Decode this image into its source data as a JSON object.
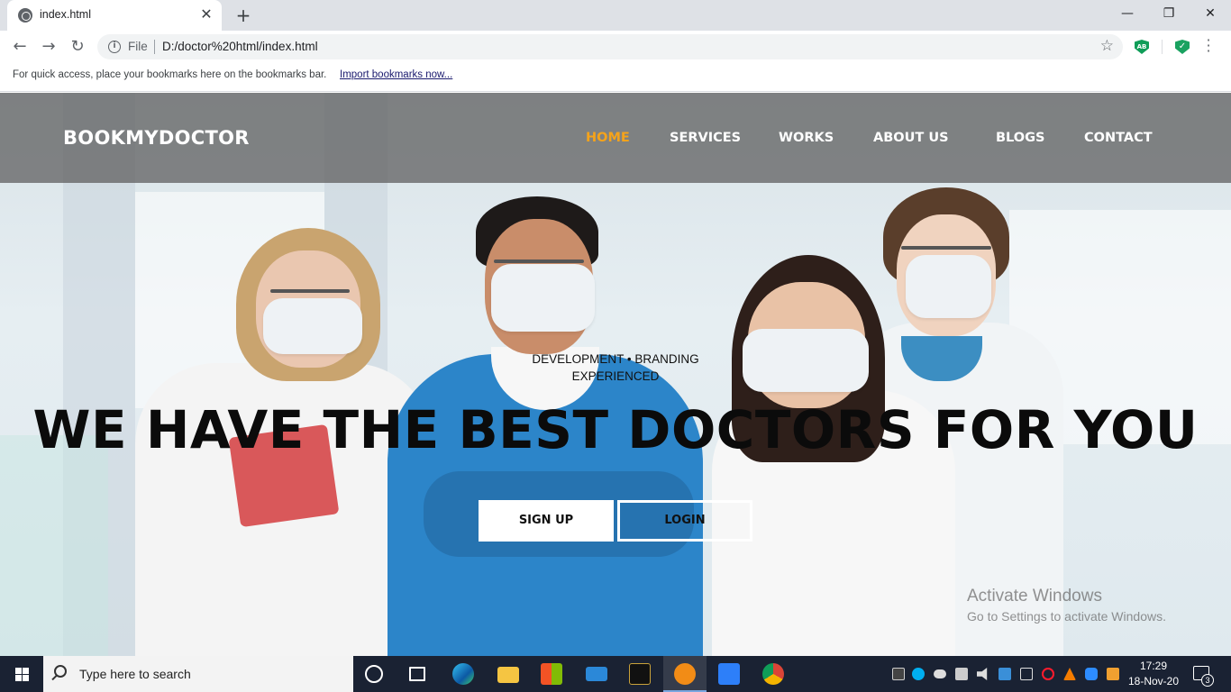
{
  "browser": {
    "tab_title": "index.html",
    "tab_close": "✕",
    "new_tab": "+",
    "minimize": "—",
    "maximize": "❐",
    "close": "✕",
    "back": "←",
    "forward": "→",
    "reload": "↻",
    "file_label": "File",
    "url": "D:/doctor%20html/index.html",
    "star": "☆",
    "ext_ab_label": "AB",
    "ext_shield_label": "✓",
    "bookmarks_text": "For quick access, place your bookmarks here on the bookmarks bar.",
    "bookmarks_link": "Import bookmarks now..."
  },
  "site": {
    "brand": "BOOKMYDOCTOR",
    "nav": [
      {
        "label": "HOME",
        "active": true
      },
      {
        "label": "SERVICES",
        "active": false
      },
      {
        "label": "WORKS",
        "active": false
      },
      {
        "label": "ABOUT US",
        "active": false
      },
      {
        "label": "BLOGS",
        "active": false
      },
      {
        "label": "CONTACT",
        "active": false
      }
    ],
    "hero_sub_line1": "DEVELOPMENT • BRANDING",
    "hero_sub_line2": "EXPERIENCED",
    "hero_title": "WE HAVE THE BEST DOCTORS FOR YOU",
    "signup_label": "SIGN UP",
    "login_label": "LOGIN",
    "accent_color": "#f5a31a"
  },
  "watermark": {
    "line1": "Activate Windows",
    "line2": "Go to Settings to activate Windows."
  },
  "taskbar": {
    "search_placeholder": "Type here to search",
    "time": "17:29",
    "date": "18-Nov-20",
    "notification_count": "3"
  }
}
